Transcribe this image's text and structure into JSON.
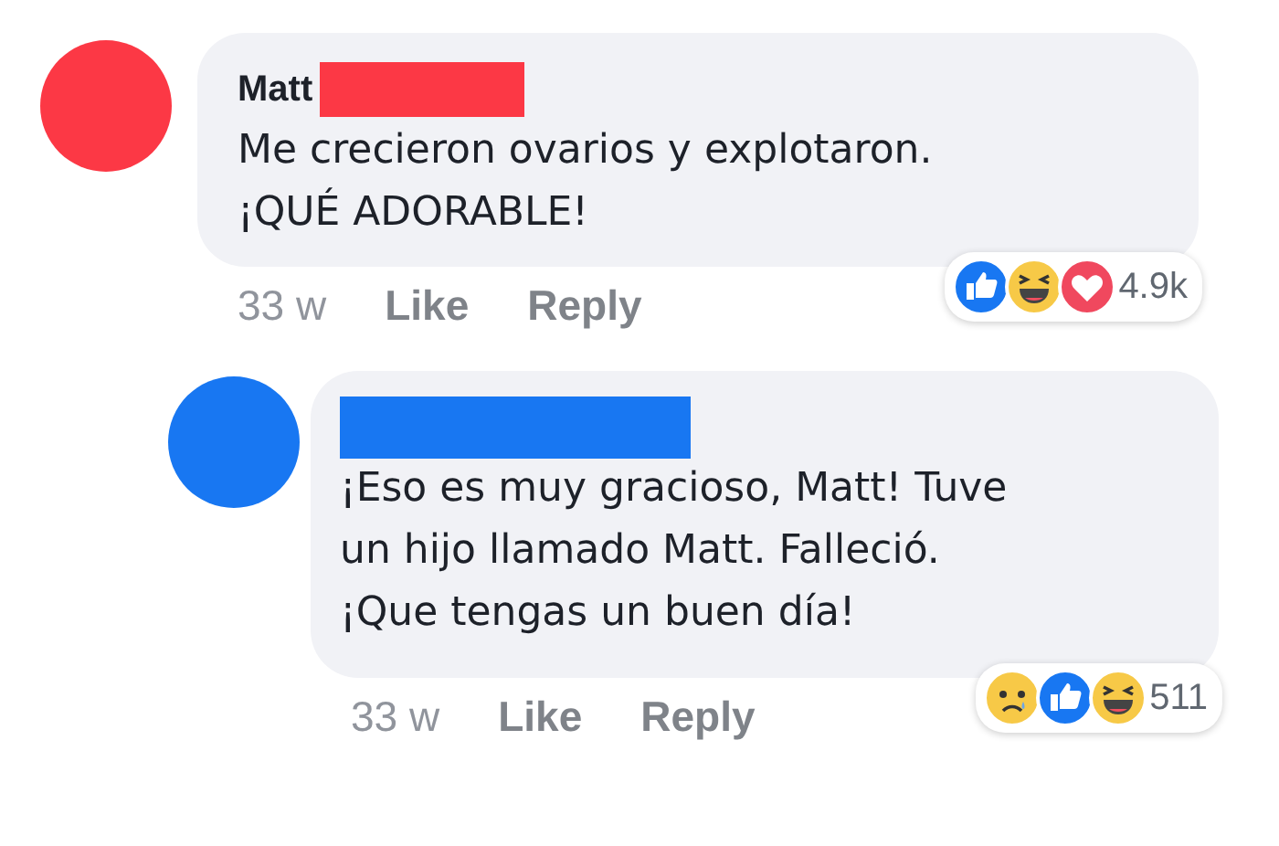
{
  "comments": [
    {
      "author": "Matt",
      "color": "#fc3845",
      "lines": [
        "Me crecieron ovarios y explotaron.",
        "¡QUÉ ADORABLE!"
      ],
      "time": "33 w",
      "actions": [
        "Like",
        "Reply"
      ],
      "reactions": [
        {
          "kind": "like"
        },
        {
          "kind": "haha"
        },
        {
          "kind": "love"
        }
      ],
      "reaction_count": "4.9k",
      "reply": false
    },
    {
      "color": "#1877f2",
      "lines": [
        "¡Eso es muy gracioso, Matt! Tuve",
        "un hijo llamado Matt. Falleció.",
        "¡Que tengas un buen día!"
      ],
      "time": "33 w",
      "actions": [
        "Like",
        "Reply"
      ],
      "reactions": [
        {
          "kind": "sad"
        },
        {
          "kind": "like"
        },
        {
          "kind": "haha"
        }
      ],
      "reaction_count": "511",
      "reply": true
    }
  ]
}
